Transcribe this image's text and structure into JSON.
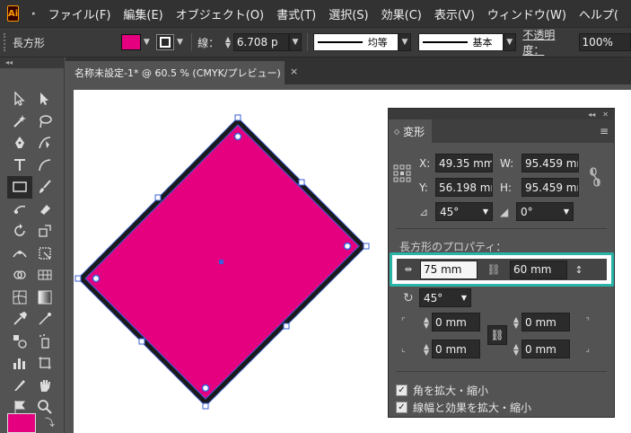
{
  "menubar": {
    "logo": "Ai",
    "items": [
      "ファイル(F)",
      "編集(E)",
      "オブジェクト(O)",
      "書式(T)",
      "選択(S)",
      "効果(C)",
      "表示(V)",
      "ウィンドウ(W)",
      "ヘルプ("
    ]
  },
  "controlbar": {
    "tool_name": "長方形",
    "fill_color": "#e4007f",
    "stroke_label": "線：",
    "stroke_weight": "6.708 p",
    "profile_label": "均等",
    "brush_label": "基本",
    "opacity_label": "不透明度：",
    "opacity_value": "100%"
  },
  "document": {
    "tab_title": "名称未設定-1* @ 60.5 % (CMYK/プレビュー)",
    "close_glyph": "×"
  },
  "shape": {
    "fill_color": "#e4007f",
    "stroke_color": "#1a1a1a",
    "selection_color": "#3a5fd9"
  },
  "transform_panel": {
    "tab_label": "変形",
    "x_label": "X:",
    "x_value": "49.35 mm",
    "y_label": "Y:",
    "y_value": "56.198 mm",
    "w_label": "W:",
    "w_value": "95.459 mm",
    "h_label": "H:",
    "h_value": "95.459 mm",
    "rotate_value": "45°",
    "shear_value": "0°",
    "section_title": "長方形のプロパティ：",
    "rect_width": "75 mm",
    "rect_height": "60 mm",
    "rect_rotate": "45°",
    "corner_tl": "0 mm",
    "corner_tr": "0 mm",
    "corner_bl": "0 mm",
    "corner_br": "0 mm",
    "scale_corners": "角を拡大・縮小",
    "scale_strokes": "線幅と効果を拡大・縮小"
  },
  "highlight_color": "#2ab3a6"
}
